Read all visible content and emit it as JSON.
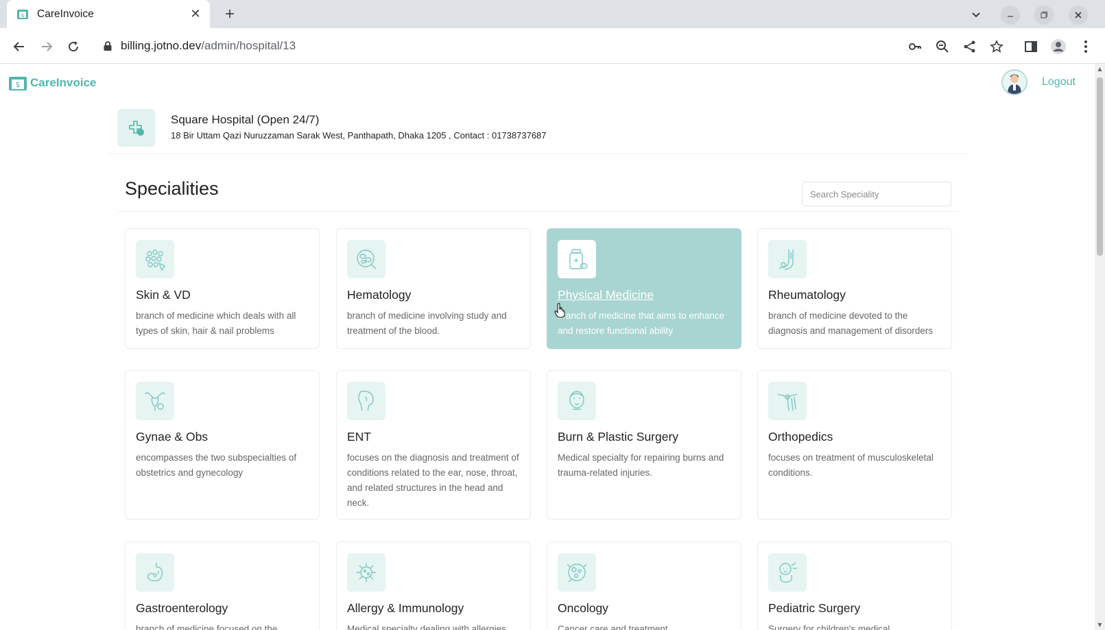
{
  "browser": {
    "tab_title": "CareInvoice",
    "tab_close": "✕",
    "new_tab": "+",
    "url_host": "billing.jotno.dev",
    "url_path": "/admin/hospital/13"
  },
  "app": {
    "logo_text": "CareInvoice",
    "logout_label": "Logout"
  },
  "hospital": {
    "name": "Square Hospital (Open 24/7)",
    "address": "18 Bir Uttam Qazi Nuruzzaman Sarak West, Panthapath, Dhaka 1205 , Contact : 01738737687"
  },
  "specialities": {
    "title": "Specialities",
    "search_placeholder": "Search Speciality",
    "items": [
      {
        "name": "Skin & VD",
        "description": "branch of medicine which deals with all types of skin, hair & nail problems",
        "icon": "skin-cells-icon"
      },
      {
        "name": "Hematology",
        "description": "branch of medicine involving study and treatment of the blood.",
        "icon": "blood-cells-icon"
      },
      {
        "name": "Physical Medicine",
        "description": "branch of medicine that aims to enhance and restore functional ability",
        "icon": "medicine-bottle-icon",
        "active": true
      },
      {
        "name": "Rheumatology",
        "description": "branch of medicine devoted to the diagnosis and management of disorders",
        "icon": "joint-icon"
      },
      {
        "name": "Gynae & Obs",
        "description": "encompasses the two subspecialties of obstetrics and gynecology",
        "icon": "uterus-icon"
      },
      {
        "name": "ENT",
        "description": "focuses on the diagnosis and treatment of conditions related to the ear, nose, throat, and related structures in the head and neck.",
        "icon": "ear-nose-throat-icon"
      },
      {
        "name": "Burn & Plastic Surgery",
        "description": "Medical specialty for repairing burns and trauma-related injuries.",
        "icon": "face-icon"
      },
      {
        "name": "Orthopedics",
        "description": "focuses on treatment of musculoskeletal conditions.",
        "icon": "bone-joint-icon"
      },
      {
        "name": "Gastroenterology",
        "description": "branch of medicine focused on the",
        "icon": "stomach-icon"
      },
      {
        "name": "Allergy & Immunology",
        "description": "Medical specialty dealing with allergies",
        "icon": "virus-icon"
      },
      {
        "name": "Oncology",
        "description": "Cancer care and treatment",
        "icon": "tumor-cell-icon"
      },
      {
        "name": "Pediatric Surgery",
        "description": "Surgery for children's medical",
        "icon": "baby-icon"
      }
    ]
  },
  "colors": {
    "accent": "#4fb6ac",
    "active_card": "#a8d5d1",
    "icon_bg": "#e6f4f2"
  }
}
